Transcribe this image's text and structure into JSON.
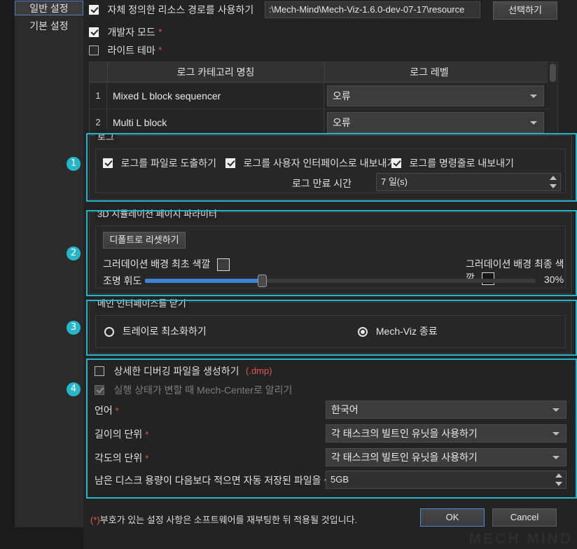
{
  "sidebar": {
    "items": [
      {
        "label": "일반 설정",
        "selected": true
      },
      {
        "label": "기본 설정",
        "selected": false
      }
    ]
  },
  "top": {
    "resource_path_checkbox": "자체 정의한 리소스 경로를 사용하기",
    "resource_path_value": ":\\Mech-Mind\\Mech-Viz-1.6.0-dev-07-17\\resource",
    "select_button": "선택하기",
    "developer_mode_checkbox": "개발자 모드",
    "developer_mode_star": "*",
    "light_theme_checkbox": "라이트 테마",
    "light_theme_star": "*"
  },
  "log_table": {
    "headers": [
      "",
      "로그 카테고리 명칭",
      "로그 레벨"
    ],
    "rows": [
      {
        "index": "1",
        "category": "Mixed L block sequencer",
        "level": "오류"
      },
      {
        "index": "2",
        "category": "Multi L block",
        "level": "오류"
      }
    ]
  },
  "sections": [
    {
      "badge": "1",
      "title": "로그"
    },
    {
      "badge": "2",
      "title": "3D 시뮬레이션 페이지 파라미터"
    },
    {
      "badge": "3",
      "title": "메인 인터페이스를 닫기"
    },
    {
      "badge": "4",
      "title": ""
    }
  ],
  "log_group": {
    "title": "로그",
    "export_to_file": "로그를 파일로 도출하기",
    "export_to_ui": "로그를 사용자 인터페이스로 내보내기",
    "export_to_cmd": "로그를 명령줄로 내보내기",
    "expire_label": "로그 만료 시간",
    "expire_value": "7 일(s)"
  },
  "sim_group": {
    "title": "3D 시뮬레이션 페이지 파라미터",
    "reset_button": "디폴트로 리셋하기",
    "gradient_start_label": "그러데이션 배경 최초 색깔",
    "gradient_start_color": "#3b3b3b",
    "gradient_end_label": "그러데이션 배경 최종 색깔",
    "gradient_end_color": "#161616",
    "brightness_label": "조명 휘도",
    "brightness_value": "30%",
    "brightness_pct": 30,
    "slider_fill_color": "#3c84d6"
  },
  "close_group": {
    "title": "메인 인터페이스를 닫기",
    "option_minimize": "트레이로 최소화하기",
    "option_exit": "Mech-Viz 종료",
    "selected": "option_exit"
  },
  "section4": {
    "debug_file_checkbox": "상세한 디버깅 파일을 생성하기",
    "debug_file_suffix": "(.dmp)",
    "notify_checkbox": "실행 상태가 변할 때 Mech-Center로 알리기",
    "language_label": "언어",
    "language_star": "*",
    "language_value": "한국어",
    "length_unit_label": "길이의 단위",
    "length_unit_star": "*",
    "length_unit_value": "각 태스크의 빌트인 유닛을 사용하기",
    "angle_unit_label": "각도의 단위",
    "angle_unit_star": "*",
    "angle_unit_value": "각 태스크의 빌트인 유닛을 사용하기",
    "disk_label": "남은 디스크 용량이 다음보다 적으면 자동 저장된 파일을 삭제하기:",
    "disk_value": "5GB"
  },
  "footer": {
    "note_mark": "(*)",
    "note_text": "부호가 있는 설정 사항은 소프트웨어를 재부팅한 뒤 적용될 것입니다.",
    "ok_button": "OK",
    "cancel_button": "Cancel",
    "watermark": "MECH MIND"
  },
  "theme": {
    "highlight_color": "#27b5c9",
    "accent_blue": "#4b8cd6",
    "required_star_color": "#e0584f"
  }
}
